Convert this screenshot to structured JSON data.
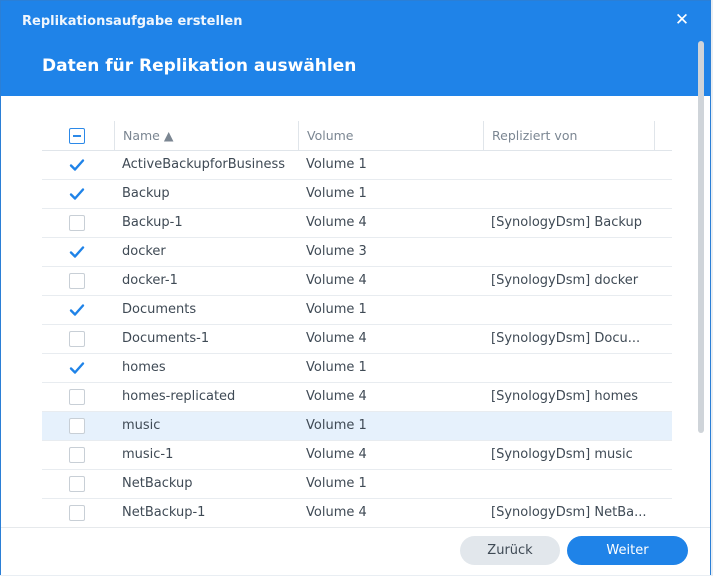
{
  "dialog": {
    "title": "Replikationsaufgabe erstellen",
    "close_glyph": "✕",
    "subtitle": "Daten für Replikation auswählen"
  },
  "table": {
    "columns": [
      "Name ▲",
      "Volume",
      "Repliziert von"
    ],
    "header_checkbox_state": "partial",
    "rows": [
      {
        "name": "ActiveBackupforBusiness",
        "volume": "Volume 1",
        "replicated_from": "",
        "checked": true
      },
      {
        "name": "Backup",
        "volume": "Volume 1",
        "replicated_from": "",
        "checked": true
      },
      {
        "name": "Backup-1",
        "volume": "Volume 4",
        "replicated_from": "[SynologyDsm] Backup",
        "checked": false
      },
      {
        "name": "docker",
        "volume": "Volume 3",
        "replicated_from": "",
        "checked": true
      },
      {
        "name": "docker-1",
        "volume": "Volume 4",
        "replicated_from": "[SynologyDsm] docker",
        "checked": false
      },
      {
        "name": "Documents",
        "volume": "Volume 1",
        "replicated_from": "",
        "checked": true
      },
      {
        "name": "Documents-1",
        "volume": "Volume 4",
        "replicated_from": "[SynologyDsm] Docu...",
        "checked": false
      },
      {
        "name": "homes",
        "volume": "Volume 1",
        "replicated_from": "",
        "checked": true
      },
      {
        "name": "homes-replicated",
        "volume": "Volume 4",
        "replicated_from": "[SynologyDsm] homes",
        "checked": false
      },
      {
        "name": "music",
        "volume": "Volume 1",
        "replicated_from": "",
        "checked": false,
        "selected": true
      },
      {
        "name": "music-1",
        "volume": "Volume 4",
        "replicated_from": "[SynologyDsm] music",
        "checked": false
      },
      {
        "name": "NetBackup",
        "volume": "Volume 1",
        "replicated_from": "",
        "checked": false
      },
      {
        "name": "NetBackup-1",
        "volume": "Volume 4",
        "replicated_from": "[SynologyDsm] NetBa...",
        "checked": false
      }
    ]
  },
  "footer": {
    "back_label": "Zurück",
    "next_label": "Weiter"
  },
  "colors": {
    "accent": "#1f83e8",
    "check": "#1f83e8",
    "selected_row": "#e6f1fc"
  }
}
